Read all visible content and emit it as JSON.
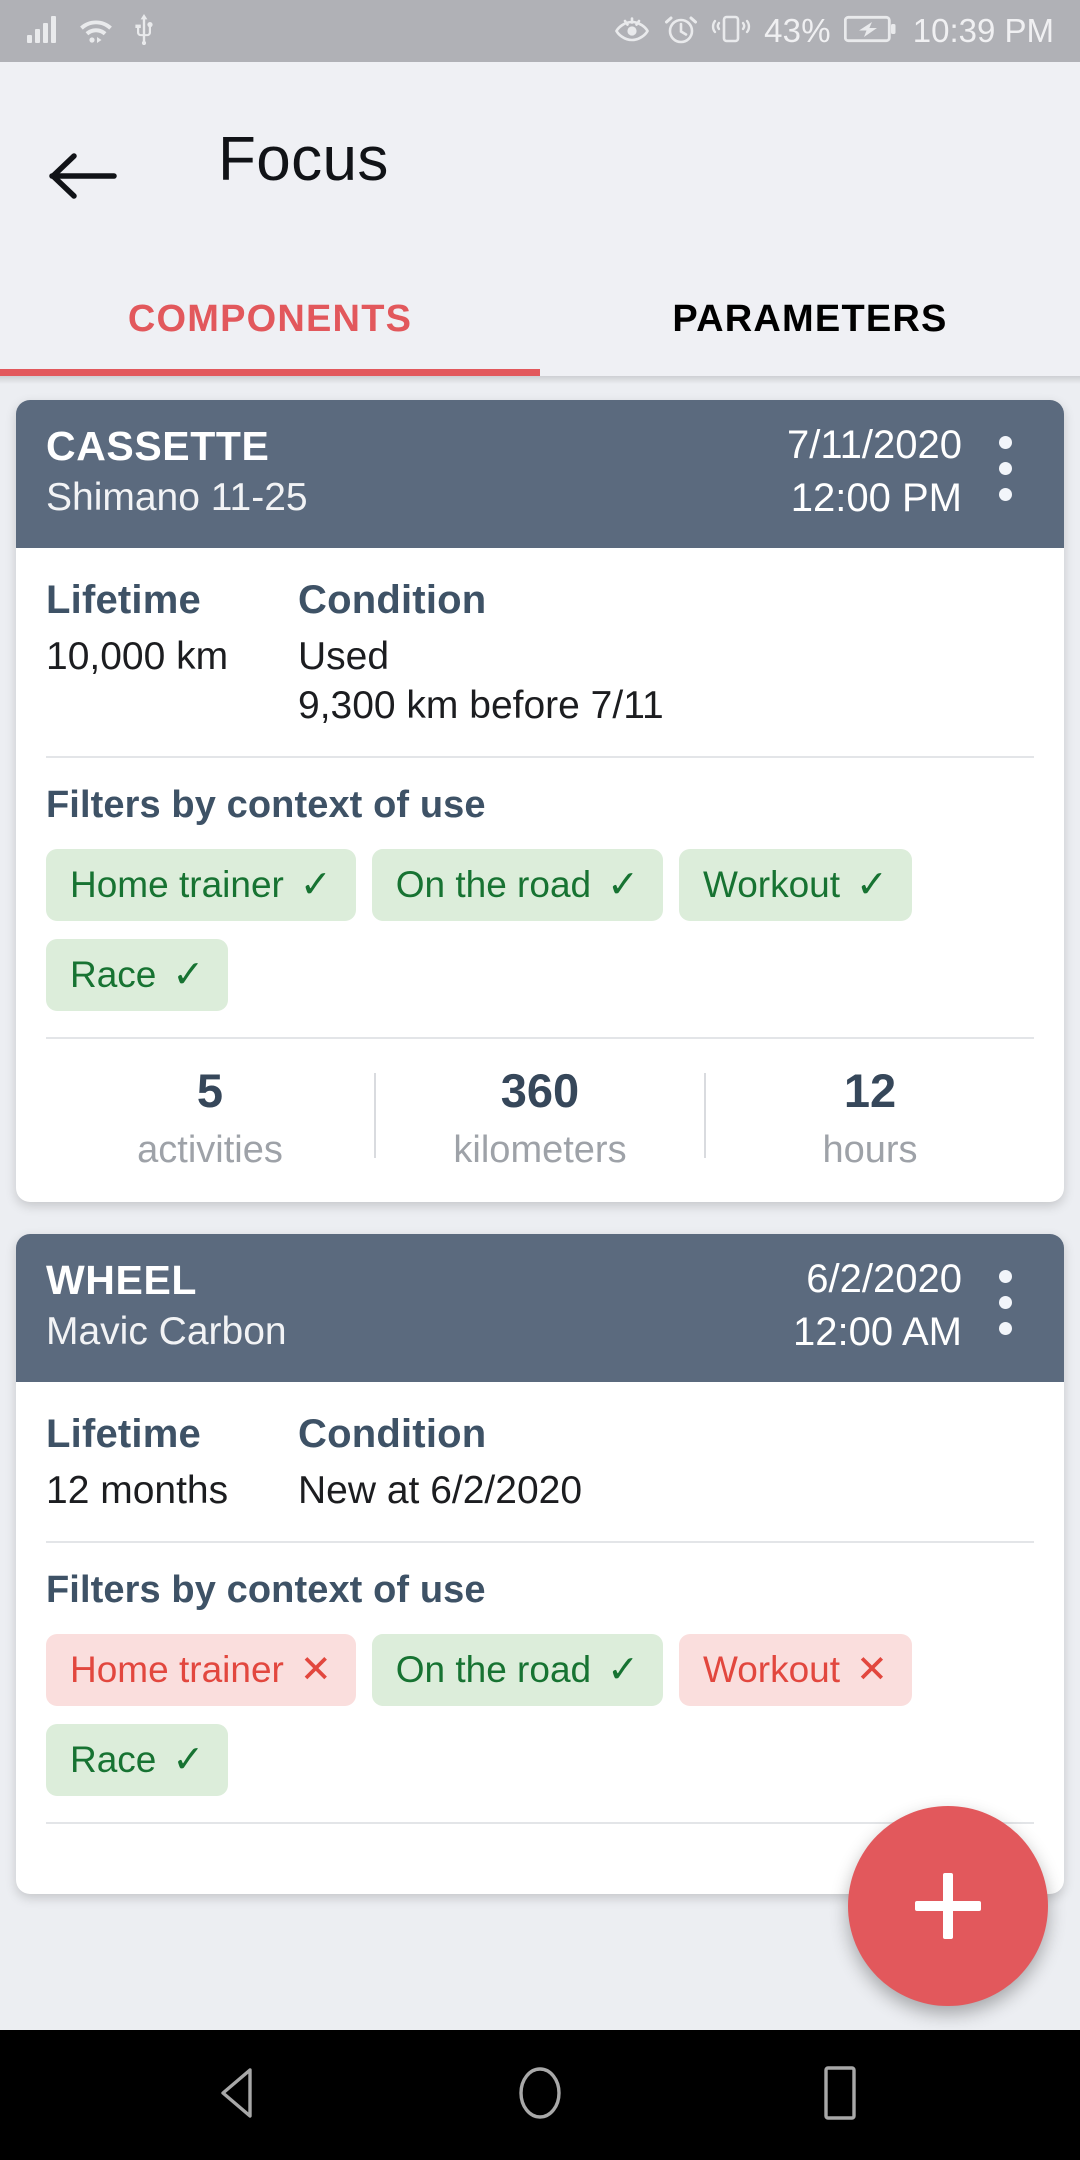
{
  "status_bar": {
    "left_icons": [
      "signal-icon",
      "wifi-icon",
      "usb-icon"
    ],
    "right_icons": [
      "eye-comfort-icon",
      "alarm-icon",
      "vibrate-icon",
      "battery-charging-icon"
    ],
    "battery_percent": "43%",
    "time": "10:39 PM"
  },
  "app_bar": {
    "back_icon": "back-arrow-icon",
    "title": "Focus"
  },
  "tabs": [
    {
      "label": "COMPONENTS",
      "active": true
    },
    {
      "label": "PARAMETERS",
      "active": false
    }
  ],
  "cards": [
    {
      "title": "CASSETTE",
      "subtitle": "Shimano 11-25",
      "date": "7/11/2020",
      "time": "12:00 PM",
      "menu_icon": "kebab-menu-icon",
      "lifetime_label": "Lifetime",
      "lifetime_value": "10,000 km",
      "condition_label": "Condition",
      "condition_value": "Used",
      "condition_detail": "9,300 km before 7/11",
      "filters_title": "Filters by context of use",
      "chips": [
        {
          "label": "Home trainer",
          "state": "on",
          "mark": "✓"
        },
        {
          "label": "On the road",
          "state": "on",
          "mark": "✓"
        },
        {
          "label": "Workout",
          "state": "on",
          "mark": "✓"
        },
        {
          "label": "Race",
          "state": "on",
          "mark": "✓"
        }
      ],
      "stats": [
        {
          "value": "5",
          "unit": "activities"
        },
        {
          "value": "360",
          "unit": "kilometers"
        },
        {
          "value": "12",
          "unit": "hours"
        }
      ]
    },
    {
      "title": "WHEEL",
      "subtitle": "Mavic Carbon",
      "date": "6/2/2020",
      "time": "12:00 AM",
      "menu_icon": "kebab-menu-icon",
      "lifetime_label": "Lifetime",
      "lifetime_value": "12 months",
      "condition_label": "Condition",
      "condition_value": "New at 6/2/2020",
      "condition_detail": "",
      "filters_title": "Filters by context of use",
      "chips": [
        {
          "label": "Home trainer",
          "state": "off",
          "mark": "✕"
        },
        {
          "label": "On the road",
          "state": "on",
          "mark": "✓"
        },
        {
          "label": "Workout",
          "state": "off",
          "mark": "✕"
        },
        {
          "label": "Race",
          "state": "on",
          "mark": "✓"
        }
      ],
      "stats": []
    }
  ],
  "fab": {
    "icon": "plus-icon",
    "label": "+"
  },
  "nav_bar": {
    "buttons": [
      {
        "name": "back-nav-button",
        "icon": "triangle-back-icon"
      },
      {
        "name": "home-nav-button",
        "icon": "circle-home-icon"
      },
      {
        "name": "recents-nav-button",
        "icon": "square-recents-icon"
      }
    ]
  },
  "colors": {
    "accent": "#e2585c",
    "card_header": "#5b6a7e",
    "chip_on_bg": "#dcedda",
    "chip_on_fg": "#177332",
    "chip_off_bg": "#fadedd",
    "chip_off_fg": "#e2473e",
    "page_bg": "#eceef2",
    "status_bar_bg": "#b0b1b6"
  }
}
